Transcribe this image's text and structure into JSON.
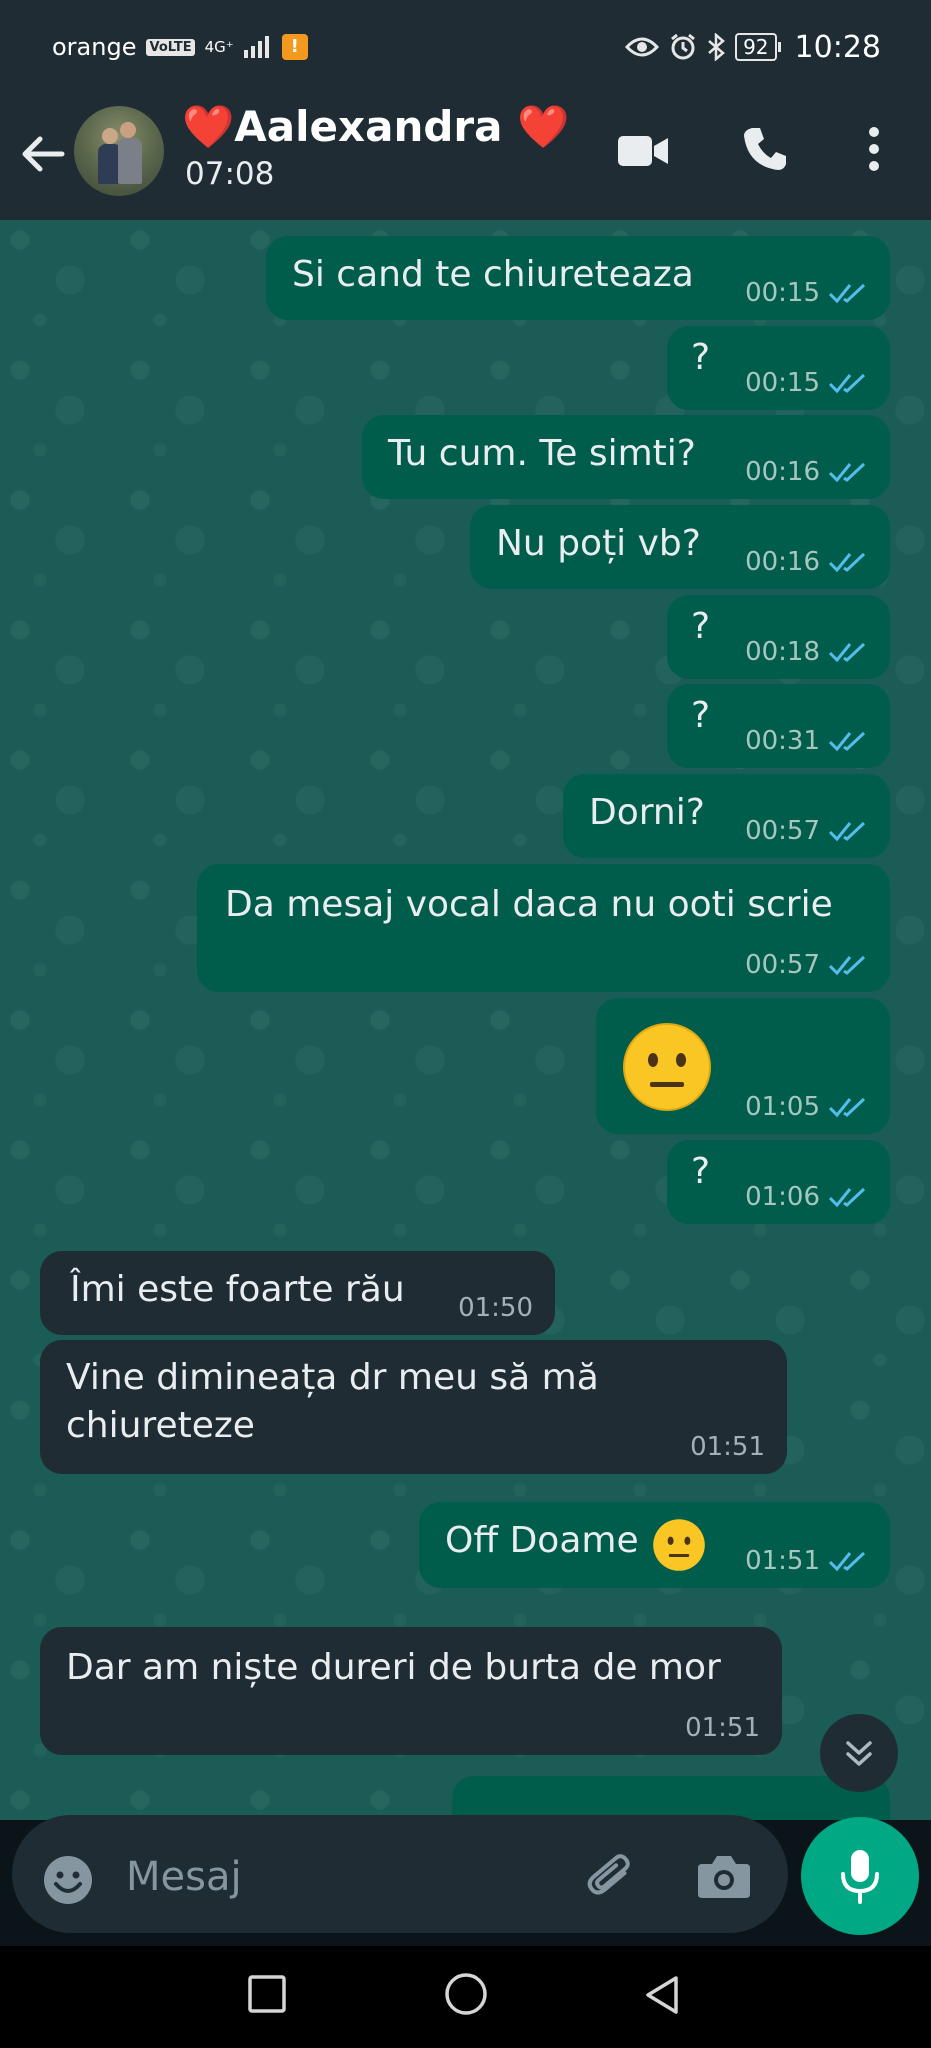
{
  "status_bar": {
    "carrier": "orange",
    "volte": "VoLTE",
    "network": "4G⁺",
    "battery": "92",
    "time": "10:28"
  },
  "app_bar": {
    "contact_name": "❤️Aalexandra ❤️",
    "contact_status": "07:08"
  },
  "messages": [
    {
      "text": "Si cand te chiureteaza",
      "time": "00:15"
    },
    {
      "text": "?",
      "time": "00:15"
    },
    {
      "text": "Tu cum. Te simti?",
      "time": "00:16"
    },
    {
      "text": "Nu poți vb?",
      "time": "00:16"
    },
    {
      "text": "?",
      "time": "00:18"
    },
    {
      "text": "?",
      "time": "00:31"
    },
    {
      "text": "Dorni?",
      "time": "00:57"
    },
    {
      "text": "Da mesaj vocal daca nu ooti scrie",
      "time": "00:57"
    },
    {
      "text": "😐",
      "time": "01:05"
    },
    {
      "text": "?",
      "time": "01:06"
    },
    {
      "text": "Îmi este foarte rău",
      "time": "01:50"
    },
    {
      "text": "Vine dimineața dr meu să mă",
      "text2": "chiureteze",
      "time": "01:51"
    },
    {
      "text": "Off Doame",
      "time": "01:51"
    },
    {
      "text": "Dar am niște dureri de burta de mor",
      "time": "01:51"
    }
  ],
  "composer": {
    "placeholder": "Mesaj"
  },
  "colors": {
    "outgoing_bubble": "#005c4b",
    "incoming_bubble": "#1f2c34",
    "chat_background": "#1b5d56",
    "accent": "#00a884",
    "read_ticks": "#53bdeb"
  },
  "icons": [
    "back-arrow-icon",
    "video-call-icon",
    "voice-call-icon",
    "more-vert-icon",
    "double-check-icon",
    "chevrons-down-icon",
    "emoji-icon",
    "attach-icon",
    "camera-icon",
    "mic-icon",
    "recent-apps-icon",
    "home-icon",
    "back-nav-icon"
  ]
}
